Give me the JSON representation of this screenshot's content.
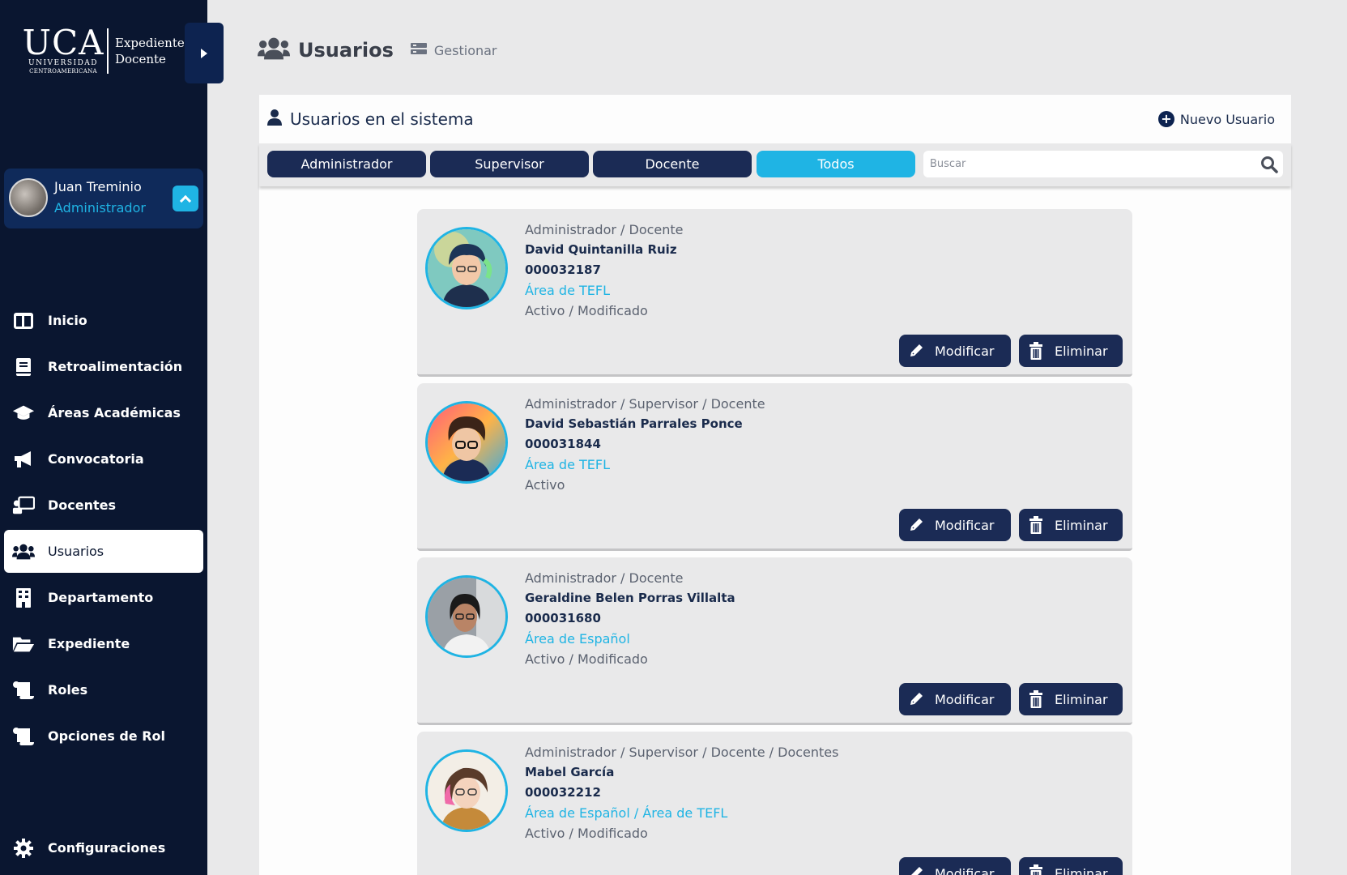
{
  "brand": {
    "uca": "UCA",
    "universidad": "UNIVERSIDAD",
    "centroamericana": "CENTROAMERICANA",
    "app_line1": "Expediente",
    "app_line2": "Docente"
  },
  "user": {
    "name": "Juan Treminio",
    "role": "Administrador"
  },
  "nav": [
    {
      "label": "Inicio",
      "icon": "dashboard-icon"
    },
    {
      "label": "Retroalimentación",
      "icon": "book-icon"
    },
    {
      "label": "Áreas Académicas",
      "icon": "graduation-cap-icon"
    },
    {
      "label": "Convocatoria",
      "icon": "megaphone-icon"
    },
    {
      "label": "Docentes",
      "icon": "teacher-icon"
    },
    {
      "label": "Usuarios",
      "icon": "users-icon",
      "active": true
    },
    {
      "label": "Departamento",
      "icon": "building-icon"
    },
    {
      "label": "Expediente",
      "icon": "folder-open-icon"
    },
    {
      "label": "Roles",
      "icon": "scroll-icon"
    },
    {
      "label": "Opciones de Rol",
      "icon": "scroll-icon"
    }
  ],
  "nav_config": {
    "label": "Configuraciones",
    "icon": "gear-icon"
  },
  "header": {
    "title": "Usuarios",
    "subtitle": "Gestionar"
  },
  "panel": {
    "title": "Usuarios en el sistema",
    "new_user": "Nuevo Usuario",
    "filters": [
      "Administrador",
      "Supervisor",
      "Docente",
      "Todos"
    ],
    "active_filter": "Todos",
    "search_placeholder": "Buscar"
  },
  "actions": {
    "modify": "Modificar",
    "delete": "Eliminar"
  },
  "users": [
    {
      "roles": "Administrador / Docente",
      "name": "David Quintanilla Ruiz",
      "code": "000032187",
      "area": "Área de TEFL",
      "status": "Activo / Modificado"
    },
    {
      "roles": "Administrador / Supervisor / Docente",
      "name": "David Sebastián Parrales Ponce",
      "code": "000031844",
      "area": "Área de TEFL",
      "status": "Activo"
    },
    {
      "roles": "Administrador / Docente",
      "name": "Geraldine Belen Porras Villalta",
      "code": "000031680",
      "area": "Área de Español",
      "status": "Activo / Modificado"
    },
    {
      "roles": "Administrador / Supervisor / Docente / Docentes",
      "name": "Mabel García",
      "code": "000032212",
      "area": "Área de Español / Área de TEFL",
      "status": "Activo / Modificado"
    }
  ],
  "colors": {
    "sidebar": "#0a1630",
    "accent": "#1fb4e4",
    "button": "#1b2b55",
    "card": "#e9e9ea"
  }
}
